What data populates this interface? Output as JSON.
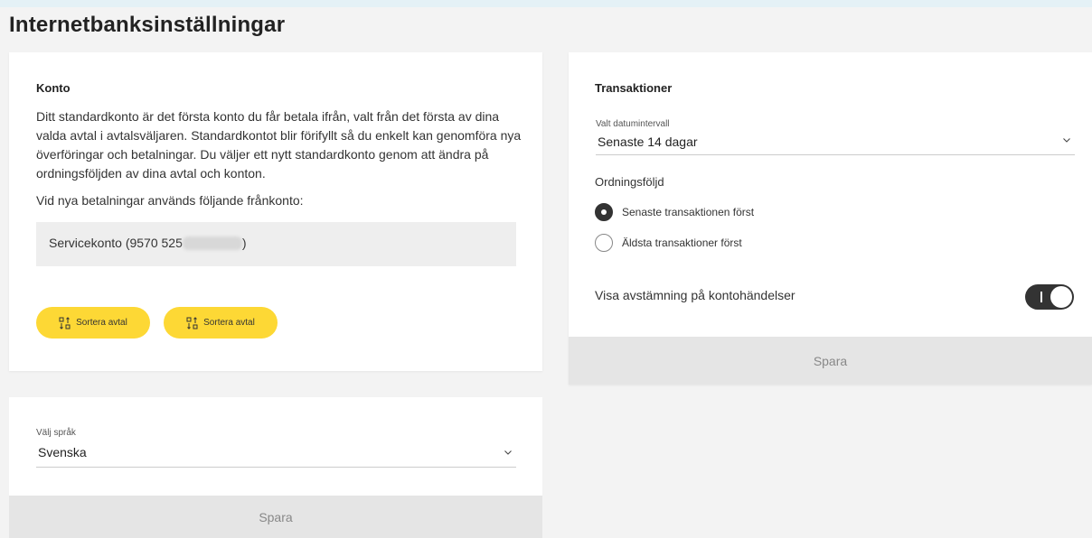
{
  "page": {
    "title": "Internetbanksinställningar"
  },
  "konto": {
    "heading": "Konto",
    "description": "Ditt standardkonto är det första konto du får betala ifrån, valt från det första av dina valda avtal i avtalsväljaren. Standardkontot blir förifyllt så du enkelt kan genomföra nya överföringar och betalningar. Du väljer ett nytt standardkonto genom att ändra på ordningsföljden av dina avtal och konton.",
    "from_account_label": "Vid nya betalningar används följande frånkonto:",
    "account_name_prefix": "Servicekonto (9570 525",
    "account_name_suffix": ")",
    "sort_button_1": "Sortera avtal",
    "sort_button_2": "Sortera avtal",
    "button_color": "#fdd835"
  },
  "transaktioner": {
    "heading": "Transaktioner",
    "date_range_label": "Valt datumintervall",
    "date_range_value": "Senaste 14 dagar",
    "order_label": "Ordningsföljd",
    "options": [
      {
        "label": "Senaste transaktionen först",
        "checked": true
      },
      {
        "label": "Äldsta transaktioner först",
        "checked": false
      }
    ],
    "reconciliation_label": "Visa avstämning på kontohändelser",
    "reconciliation_on": true,
    "save_label": "Spara"
  },
  "language": {
    "label": "Välj språk",
    "value": "Svenska",
    "save_label": "Spara"
  }
}
